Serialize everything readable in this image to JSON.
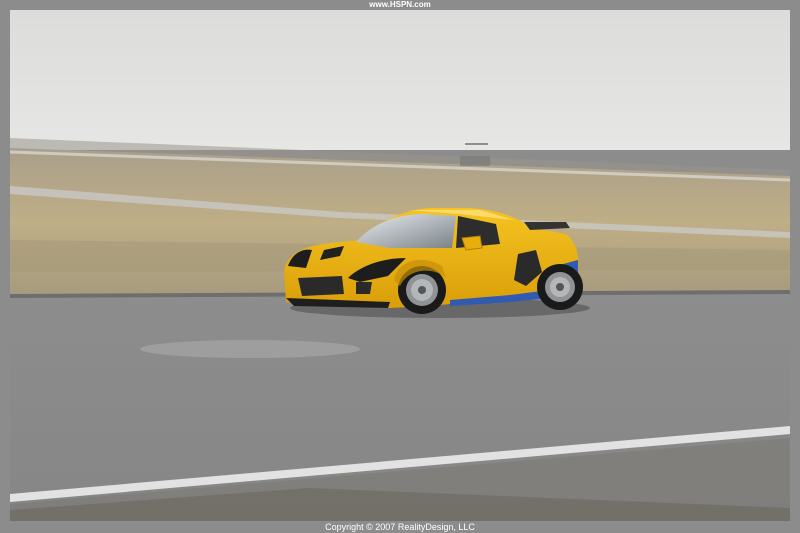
{
  "header": {
    "site_url": "www.HSPN.com"
  },
  "footer": {
    "copyright": "Copyright © 2007 RealityDesign, LLC"
  },
  "photo": {
    "subject": "yellow-sports-car",
    "colors": {
      "sky": "#e0e0df",
      "grass": "#b8a887",
      "track": "#8b8b8b",
      "car_yellow": "#f2b90f",
      "car_blue": "#2b55a8"
    }
  }
}
